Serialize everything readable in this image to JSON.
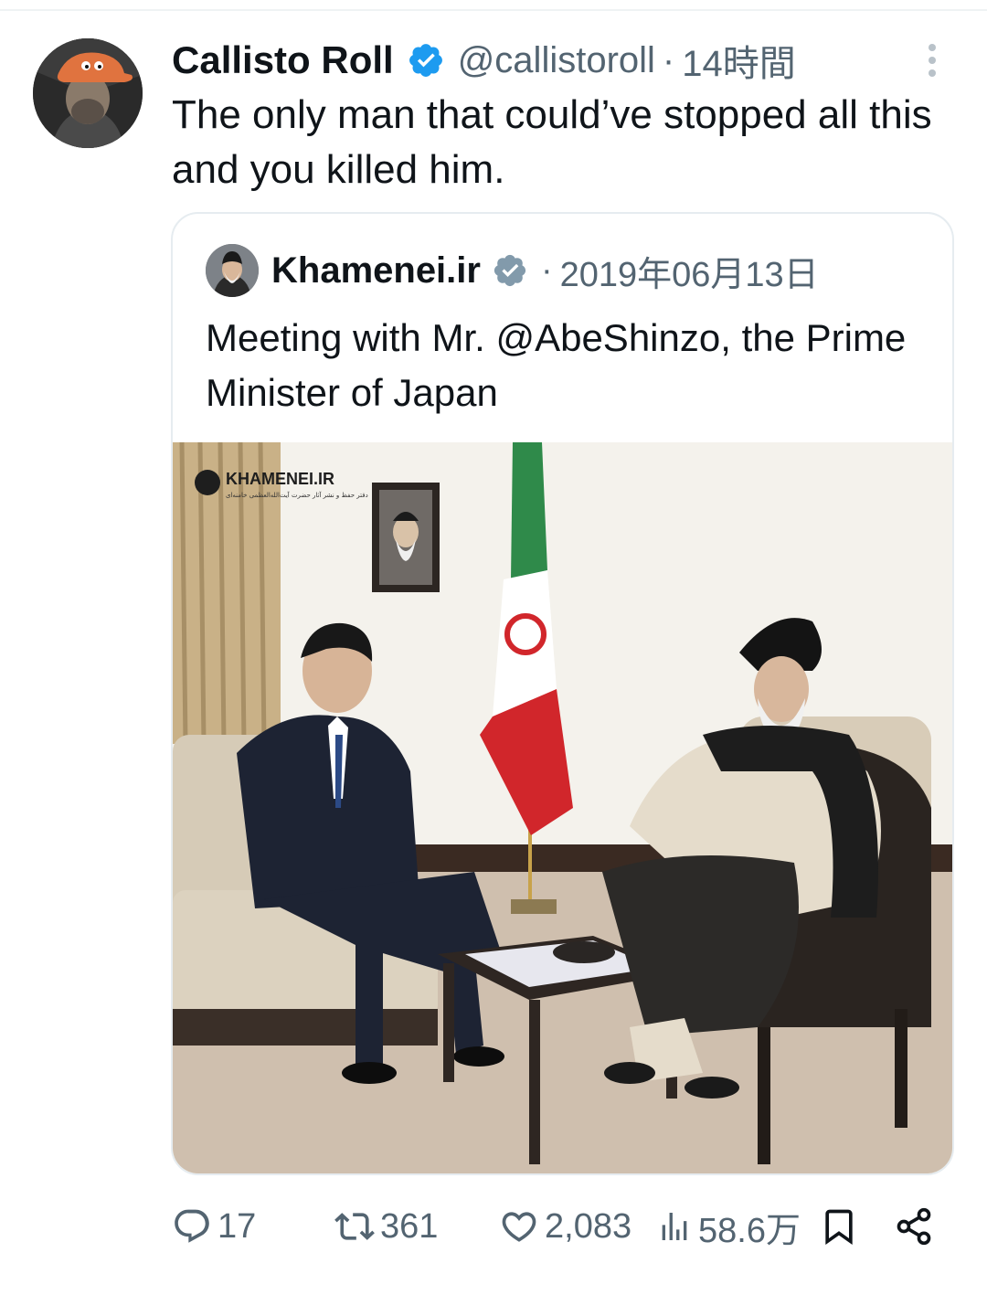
{
  "tweet": {
    "display_name": "Callisto Roll",
    "handle": "@callistoroll",
    "separator": "·",
    "time": "14時間",
    "text": "The only man that could’ve stopped all this and you killed him.",
    "avatar_icon": "user-avatar",
    "verified_icon": "verified-badge-icon",
    "colors": {
      "verified": "#1d9bf0",
      "secondary_text": "#536471",
      "primary_text": "#0f1419"
    }
  },
  "quoted": {
    "display_name": "Khamenei.ir",
    "separator": "·",
    "date": "2019年06月13日",
    "text": "Meeting with Mr. @AbeShinzo, the Prime Minister of Japan",
    "verified_icon": "verified-badge-gray-icon",
    "photo": {
      "watermark": "KHAMENEI.IR",
      "watermark_sub": "دفتر حفظ و نشر آثار حضرت آیت‌الله‌العظمی خامنه‌ای",
      "icon": "meeting-photo"
    }
  },
  "actions": {
    "reply": {
      "icon": "reply-icon",
      "count": "17"
    },
    "retweet": {
      "icon": "retweet-icon",
      "count": "361"
    },
    "like": {
      "icon": "heart-icon",
      "count": "2,083"
    },
    "views": {
      "icon": "views-chart-icon",
      "count": "58.6万"
    },
    "bookmark": {
      "icon": "bookmark-icon"
    },
    "share": {
      "icon": "share-icon"
    }
  }
}
